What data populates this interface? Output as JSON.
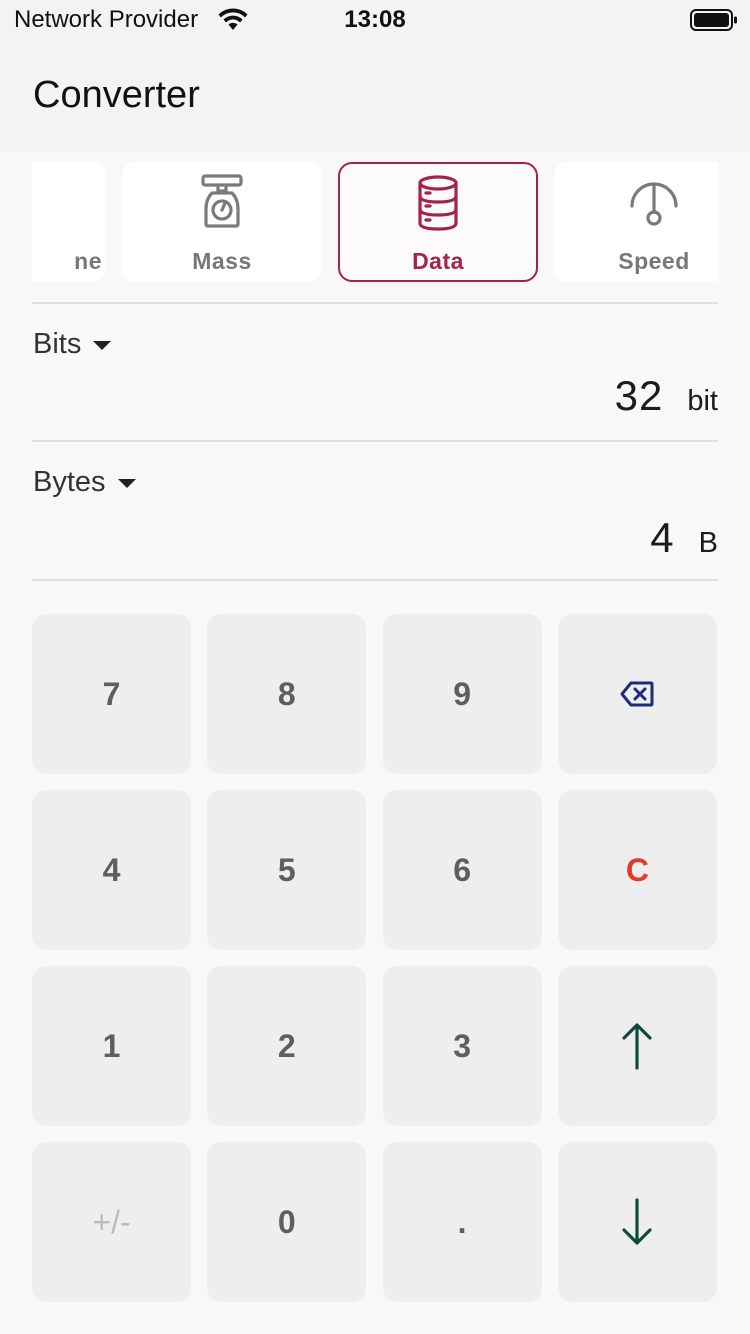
{
  "status_bar": {
    "carrier": "Network Provider",
    "time": "13:08"
  },
  "app": {
    "title": "Converter"
  },
  "categories": [
    {
      "label": "ne",
      "icon": "clock-icon",
      "selected": false
    },
    {
      "label": "Mass",
      "icon": "scale-icon",
      "selected": false
    },
    {
      "label": "Data",
      "icon": "database-icon",
      "selected": true
    },
    {
      "label": "Speed",
      "icon": "speedometer-icon",
      "selected": false
    }
  ],
  "from_unit": {
    "name": "Bits",
    "value": "32",
    "symbol": "bit"
  },
  "to_unit": {
    "name": "Bytes",
    "value": "4",
    "symbol": "B"
  },
  "keypad": {
    "keys": [
      "7",
      "8",
      "9",
      "4",
      "5",
      "6",
      "C",
      "1",
      "2",
      "3",
      "+/-",
      "0",
      "."
    ],
    "icons": {
      "backspace": "backspace-icon",
      "swap_up": "arrow-up-icon",
      "swap_down": "arrow-down-icon"
    }
  },
  "colors": {
    "accent": "#a4224c",
    "clear": "#e5392a",
    "arrow": "#0e4a3b",
    "backspace": "#1f2a7a"
  }
}
